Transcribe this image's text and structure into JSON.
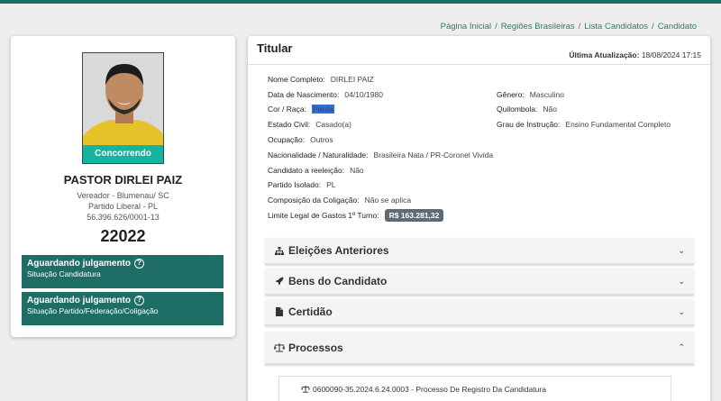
{
  "breadcrumb": [
    "Página Inicial",
    "Regiões Brasileiras",
    "Lista Candidatos",
    "Candidato"
  ],
  "candidate": {
    "status_ribbon": "Concorrendo",
    "name": "PASTOR DIRLEI PAIZ",
    "office_location": "Vereador - Blumenau/ SC",
    "party": "Partido Liberal - PL",
    "cnpj": "56.396.626/0001-13",
    "number": "22022",
    "status_boxes": [
      {
        "title": "Aguardando julgamento",
        "subtitle": "Situação Candidatura"
      },
      {
        "title": "Aguardando julgamento",
        "subtitle": "Situação Partido/Federação/Coligação"
      }
    ]
  },
  "main": {
    "title": "Titular",
    "last_update_label": "Última Atualização:",
    "last_update_value": "18/08/2024 17:15",
    "fields": {
      "nome_completo": {
        "label": "Nome Completo:",
        "value": "DIRLEI PAIZ"
      },
      "data_nascimento": {
        "label": "Data de Nascimento:",
        "value": "04/10/1980"
      },
      "genero": {
        "label": "Gênero:",
        "value": "Masculino"
      },
      "cor_raca": {
        "label": "Cor / Raça:",
        "value": "Parda"
      },
      "quilombola": {
        "label": "Quilombola:",
        "value": "Não"
      },
      "estado_civil": {
        "label": "Estado Civil:",
        "value": "Casado(a)"
      },
      "grau_instrucao": {
        "label": "Grau de Instrução:",
        "value": "Ensino Fundamental Completo"
      },
      "ocupacao": {
        "label": "Ocupação:",
        "value": "Outros"
      },
      "nacionalidade": {
        "label": "Nacionalidade / Naturalidade:",
        "value": "Brasileira Nata / PR-Coronel Vivida"
      },
      "reeleicao": {
        "label": "Candidato a reeleição:",
        "value": "Não"
      },
      "partido_isolado": {
        "label": "Partido Isolado:",
        "value": "PL"
      },
      "composicao": {
        "label": "Composição da Coligação:",
        "value": "Não se aplica"
      },
      "limite_gastos": {
        "label": "Limite Legal de Gastos 1º Turno:",
        "value": "R$ 163.281,32"
      }
    },
    "accordions": [
      {
        "label": "Eleições Anteriores",
        "icon": "sitemap-icon",
        "expanded": false
      },
      {
        "label": "Bens do Candidato",
        "icon": "rocket-icon",
        "expanded": false
      },
      {
        "label": "Certidão",
        "icon": "file-icon",
        "expanded": false
      },
      {
        "label": "Processos",
        "icon": "balance-scale-icon",
        "expanded": true
      }
    ],
    "process_row": "0600090-35.2024.6.24.0003 - Processo De Registro Da Candidatura"
  },
  "colors": {
    "accent": "#1f6e66",
    "ribbon": "#17b3a1",
    "topbar": "#1e6b63"
  }
}
